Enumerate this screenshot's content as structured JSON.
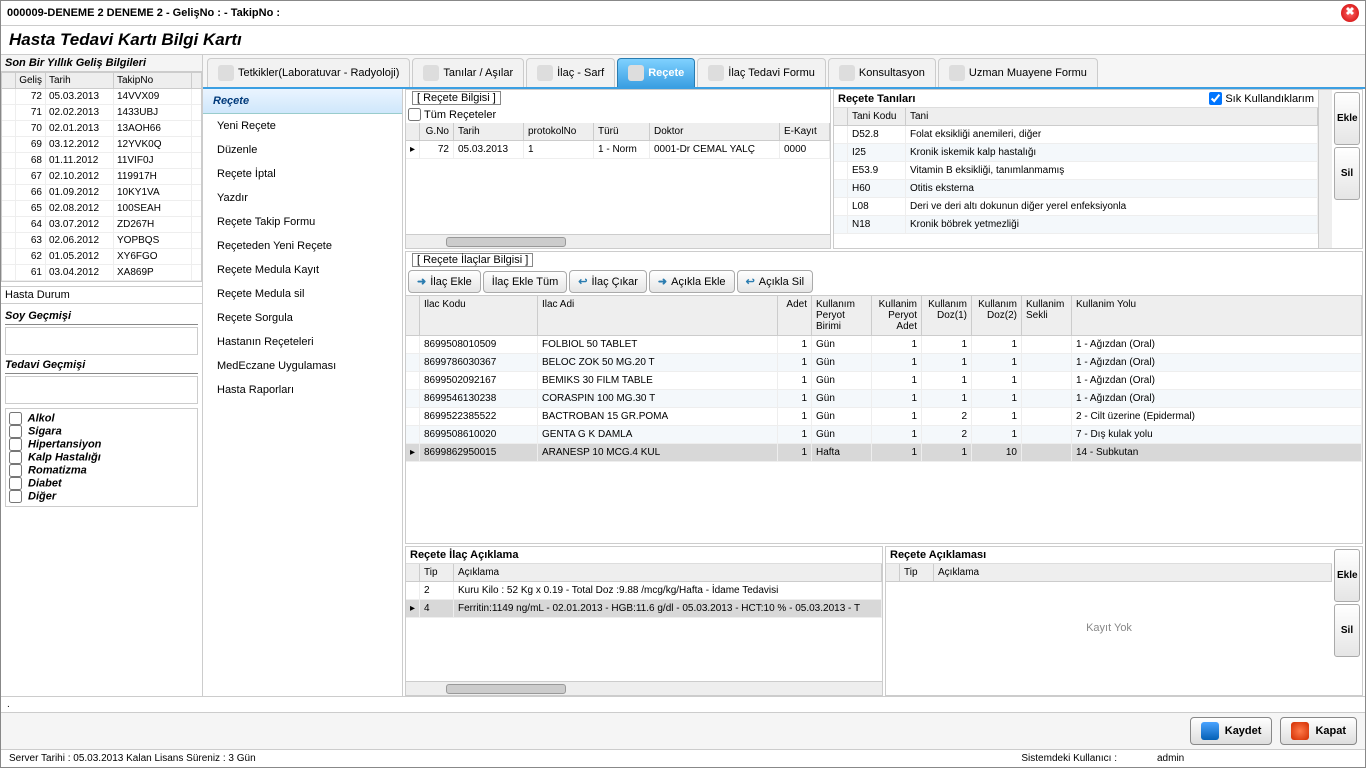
{
  "window": {
    "title": "000009-DENEME 2 DENEME 2 - GelişNo :  - TakipNo :"
  },
  "page_title": "Hasta Tedavi Kartı Bilgi Kartı",
  "visits": {
    "title": "Son Bir Yıllık Geliş Bilgileri",
    "headers": [
      "",
      "Geliş",
      "Tarih",
      "TakipNo"
    ],
    "rows": [
      [
        "",
        "72",
        "05.03.2013",
        "14VVX09"
      ],
      [
        "",
        "71",
        "02.02.2013",
        "1433UBJ"
      ],
      [
        "",
        "70",
        "02.01.2013",
        "13AOH66"
      ],
      [
        "",
        "69",
        "03.12.2012",
        "12YVK0Q"
      ],
      [
        "",
        "68",
        "01.11.2012",
        "11VIF0J"
      ],
      [
        "",
        "67",
        "02.10.2012",
        "119917H"
      ],
      [
        "",
        "66",
        "01.09.2012",
        "10KY1VA"
      ],
      [
        "",
        "65",
        "02.08.2012",
        "100SEAH"
      ],
      [
        "",
        "64",
        "03.07.2012",
        "ZD267H"
      ],
      [
        "",
        "63",
        "02.06.2012",
        "YOPBQS"
      ],
      [
        "",
        "62",
        "01.05.2012",
        "XY6FGO"
      ],
      [
        "",
        "61",
        "03.04.2012",
        "XA869P"
      ]
    ]
  },
  "left_panels": {
    "hasta_durum": "Hasta Durum",
    "soy": "Soy Geçmişi",
    "tedavi": "Tedavi Geçmişi",
    "checks": [
      "Alkol",
      "Sigara",
      "Hipertansiyon",
      "Kalp Hastalığı",
      "Romatizma",
      "Diabet",
      "Diğer"
    ]
  },
  "tabs": [
    "Tetkikler(Laboratuvar - Radyoloji)",
    "Tanılar / Aşılar",
    "İlaç - Sarf",
    "Reçete",
    "İlaç Tedavi Formu",
    "Konsultasyon",
    "Uzman Muayene Formu"
  ],
  "active_tab": 3,
  "menu": {
    "title": "Reçete",
    "items": [
      "Yeni Reçete",
      "Düzenle",
      "Reçete İptal",
      "Yazdır",
      "Reçete Takip Formu",
      "Reçeteden Yeni Reçete",
      "Reçete Medula Kayıt",
      "Reçete Medula sil",
      "Reçete Sorgula",
      "Hastanın Reçeteleri",
      "MedEczane Uygulaması",
      "Hasta Raporları"
    ]
  },
  "recete_bilgisi": {
    "label": "[ Reçete Bilgisi ]",
    "tum": "Tüm Reçeteler",
    "headers": [
      "",
      "G.No",
      "Tarih",
      "protokolNo",
      "Türü",
      "Doktor",
      "E-Kayıt"
    ],
    "row": [
      "▸",
      "72",
      "05.03.2013",
      "1",
      "1 - Norm",
      "0001-Dr CEMAL YALÇ",
      "0000"
    ]
  },
  "tanilar": {
    "title": "Reçete Tanıları",
    "sik": "Sık Kullandıklarım",
    "headers": [
      "",
      "Tani Kodu",
      "Tani"
    ],
    "rows": [
      [
        "",
        "D52.8",
        "Folat eksikliği anemileri, diğer"
      ],
      [
        "",
        "I25",
        "Kronik iskemik kalp hastalığı"
      ],
      [
        "",
        "E53.9",
        "Vitamin B eksikliği, tanımlanmamış"
      ],
      [
        "",
        "H60",
        "Otitis eksterna"
      ],
      [
        "",
        "L08",
        "Deri ve deri altı dokunun diğer yerel enfeksiyonla"
      ],
      [
        "",
        "N18",
        "Kronik böbrek yetmezliği"
      ]
    ],
    "ekle": "Ekle",
    "sil": "Sil"
  },
  "ilaclar": {
    "label": "[ Reçete İlaçlar Bilgisi ]",
    "buttons": {
      "ekle": "İlaç Ekle",
      "ekle_tum": "İlaç Ekle Tüm",
      "cikar": "İlaç Çıkar",
      "ac_ekle": "Açıkla Ekle",
      "ac_sil": "Açıkla Sil"
    },
    "headers": [
      "",
      "Ilac Kodu",
      "Ilac Adi",
      "Adet",
      "Kullanım Peryot Birimi",
      "Kullanim Peryot Adet",
      "Kullanım Doz(1)",
      "Kullanım Doz(2)",
      "Kullanim Sekli",
      "Kullanim Yolu"
    ],
    "rows": [
      [
        "",
        "8699508010509",
        "FOLBIOL 50 TABLET",
        "1",
        "Gün",
        "1",
        "1",
        "1",
        "",
        "1 - Ağızdan (Oral)"
      ],
      [
        "",
        "8699786030367",
        "BELOC ZOK 50 MG.20 T",
        "1",
        "Gün",
        "1",
        "1",
        "1",
        "",
        "1 - Ağızdan (Oral)"
      ],
      [
        "",
        "8699502092167",
        "BEMIKS 30 FILM TABLE",
        "1",
        "Gün",
        "1",
        "1",
        "1",
        "",
        "1 - Ağızdan (Oral)"
      ],
      [
        "",
        "8699546130238",
        "CORASPIN 100 MG.30 T",
        "1",
        "Gün",
        "1",
        "1",
        "1",
        "",
        "1 - Ağızdan (Oral)"
      ],
      [
        "",
        "8699522385522",
        "BACTROBAN 15 GR.POMA",
        "1",
        "Gün",
        "1",
        "2",
        "1",
        "",
        "2 - Cilt üzerine (Epidermal)"
      ],
      [
        "",
        "8699508610020",
        "GENTA G K DAMLA",
        "1",
        "Gün",
        "1",
        "2",
        "1",
        "",
        "7 - Dış kulak yolu"
      ],
      [
        "▸",
        "8699862950015",
        "ARANESP  10 MCG.4 KUL",
        "1",
        "Hafta",
        "1",
        "1",
        "10",
        "",
        "14 - Subkutan"
      ]
    ]
  },
  "ilac_aciklama": {
    "title": "Reçete İlaç Açıklama",
    "headers": [
      "",
      "Tip",
      "Açıklama"
    ],
    "rows": [
      [
        "",
        "2",
        "Kuru Kilo : 52 Kg x 0.19 - Total Doz :9.88 /mcg/kg/Hafta - İdame Tedavisi"
      ],
      [
        "▸",
        "4",
        "Ferritin:1149 ng/mL - 02.01.2013 - HGB:11.6 g/dl - 05.03.2013 - HCT:10 % - 05.03.2013 - T"
      ]
    ]
  },
  "recete_aciklama": {
    "title": "Reçete Açıklaması",
    "headers": [
      "",
      "Tip",
      "Açıklama"
    ],
    "empty": "Kayıt Yok",
    "ekle": "Ekle",
    "sil": "Sil"
  },
  "actions": {
    "save": "Kaydet",
    "close": "Kapat"
  },
  "footer": {
    "server": "Server Tarihi : 05.03.2013  Kalan Lisans Süreniz : 3 Gün",
    "user_label": "Sistemdeki Kullanıcı :",
    "user": "admin"
  }
}
